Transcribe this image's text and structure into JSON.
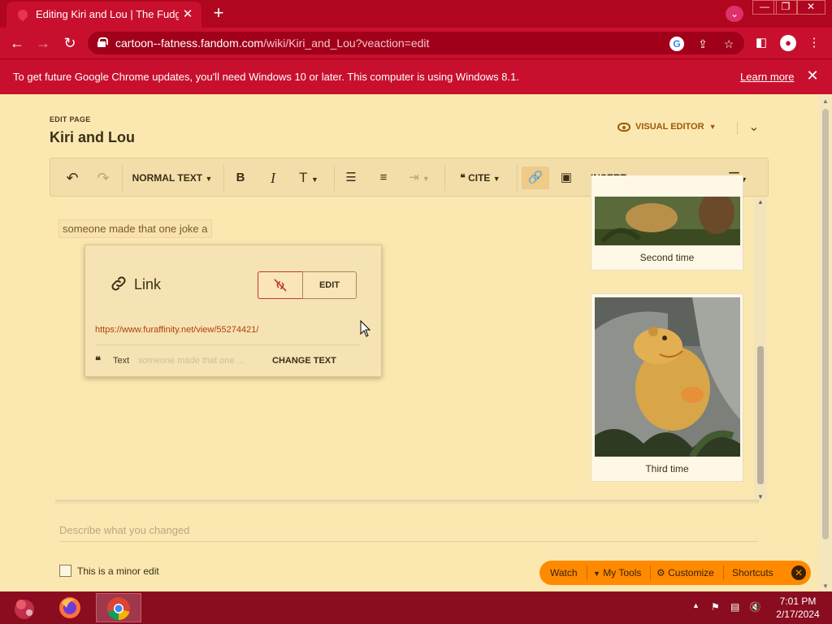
{
  "browser": {
    "tab_title": "Editing Kiri and Lou | The Fudge",
    "tab_close": "✕",
    "new_tab": "+",
    "url_host": "cartoon--fatness.fandom.com",
    "url_path": "/wiki/Kiri_and_Lou?veaction=edit",
    "window_controls": [
      "—",
      "❐",
      "✕"
    ]
  },
  "infobar": {
    "message": "To get future Google Chrome updates, you'll need Windows 10 or later. This computer is using Windows 8.1.",
    "learn_more": "Learn more",
    "close": "✕"
  },
  "header": {
    "edit_label": "EDIT PAGE",
    "page_title": "Kiri and Lou",
    "visual_editor": "VISUAL EDITOR"
  },
  "editor_toolbar": {
    "paragraph": "NORMAL TEXT",
    "cite": "CITE",
    "insert": "INSERT"
  },
  "content": {
    "selected_text": "someone made that one joke a"
  },
  "link_popup": {
    "title": "Link",
    "edit": "EDIT",
    "url": "https://www.furaffinity.net/view/55274421/",
    "text_label": "Text",
    "text_value": "someone made that one ...",
    "change_text": "CHANGE TEXT"
  },
  "thumbnails": [
    {
      "caption": "Second time"
    },
    {
      "caption": "Third time"
    }
  ],
  "footer": {
    "summary_placeholder": "Describe what you changed",
    "minor_edit": "This is a minor edit",
    "minor_edit_checked": false
  },
  "fandom_bar": {
    "watch": "Watch",
    "my_tools": "My Tools",
    "customize": "Customize",
    "shortcuts": "Shortcuts"
  },
  "taskbar": {
    "time": "7:01 PM",
    "date": "2/17/2024"
  },
  "colors": {
    "chrome_red": "#c8102e",
    "page_bg": "#fbe8b0",
    "accent_orange": "#ff8a00",
    "link_color": "#b0400a"
  }
}
